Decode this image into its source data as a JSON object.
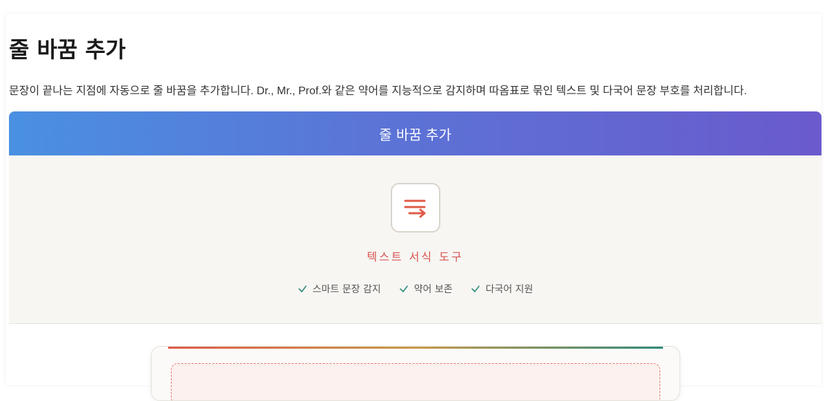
{
  "page": {
    "title": "줄 바꿈 추가",
    "description": "문장이 끝나는 지점에 자동으로 줄 바꿈을 추가합니다. Dr., Mr., Prof.와 같은 약어를 지능적으로 감지하며 따옴표로 묶인 텍스트 및 다국어 문장 부호를 처리합니다."
  },
  "card": {
    "header_title": "줄 바꿈 추가",
    "tool_icon": "line-wrap-icon",
    "tool_label": "텍스트 서식 도구",
    "features": [
      {
        "icon": "check-icon",
        "label": "스마트 문장 감지"
      },
      {
        "icon": "check-icon",
        "label": "약어 보존"
      },
      {
        "icon": "check-icon",
        "label": "다국어 지원"
      }
    ]
  },
  "colors": {
    "header_gradient_start": "#4a90e2",
    "header_gradient_end": "#6a5acd",
    "accent": "#d9534f",
    "check": "#2e8b7a",
    "hero_bg": "#f7f6f3"
  }
}
